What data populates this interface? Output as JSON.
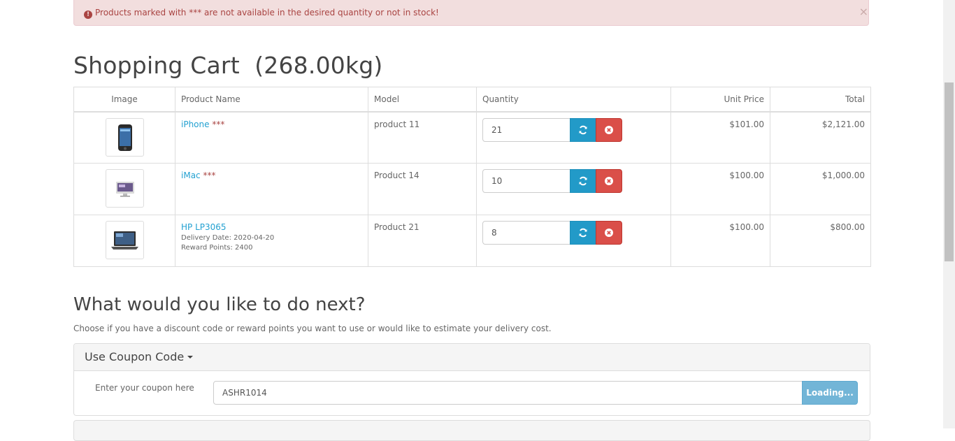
{
  "alert": {
    "icon": "exclamation-circle-icon",
    "message": "Products marked with *** are not available in the desired quantity or not in stock!",
    "close": "×"
  },
  "cart": {
    "title": "Shopping Cart  (268.00kg)",
    "headers": {
      "image": "Image",
      "product_name": "Product Name",
      "model": "Model",
      "quantity": "Quantity",
      "unit_price": "Unit Price",
      "total": "Total"
    },
    "rows": [
      {
        "image_icon": "iphone-thumbnail",
        "name": "iPhone",
        "stock_marker": "***",
        "model": "product 11",
        "quantity": "21",
        "unit_price": "$101.00",
        "total": "$2,121.00"
      },
      {
        "image_icon": "imac-thumbnail",
        "name": "iMac",
        "stock_marker": "***",
        "model": "Product 14",
        "quantity": "10",
        "unit_price": "$100.00",
        "total": "$1,000.00"
      },
      {
        "image_icon": "laptop-thumbnail",
        "name": "HP LP3065",
        "delivery": "Delivery Date: 2020-04-20",
        "reward": "Reward Points: 2400",
        "model": "Product 21",
        "quantity": "8",
        "unit_price": "$100.00",
        "total": "$800.00"
      }
    ]
  },
  "next": {
    "heading": "What would you like to do next?",
    "subtitle": "Choose if you have a discount code or reward points you want to use or would like to estimate your delivery cost."
  },
  "coupon": {
    "panel_title": "Use Coupon Code",
    "label": "Enter your coupon here",
    "value": "ASHR1014",
    "button": "Loading..."
  },
  "colors": {
    "link": "#23a1d1",
    "danger": "#da4f49",
    "primary": "#229ac8",
    "alert_bg": "#f2dede"
  }
}
